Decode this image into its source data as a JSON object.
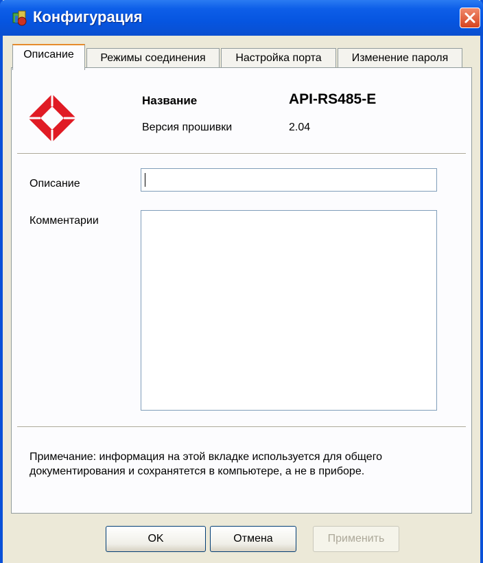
{
  "window": {
    "title": "Конфигурация",
    "close_icon": "close-x-icon",
    "app_icon": "configuration-tools-icon"
  },
  "tabs": [
    {
      "label": "Описание",
      "active": true
    },
    {
      "label": "Режимы соединения",
      "active": false
    },
    {
      "label": "Настройка порта",
      "active": false
    },
    {
      "label": "Изменение пароля",
      "active": false
    }
  ],
  "device": {
    "logo_icon": "red-diamond-logo",
    "name_label": "Название",
    "name_value": "API-RS485-E",
    "firmware_label": "Версия прошивки",
    "firmware_value": "2.04"
  },
  "form": {
    "description_label": "Описание",
    "description_value": "",
    "comments_label": "Комментарии",
    "comments_value": ""
  },
  "note": {
    "line1": "Примечание: информация на этой вкладке используется для общего",
    "line2": "документирования и сохранятется в компьютере, а не в приборе."
  },
  "buttons": {
    "ok": "OK",
    "cancel": "Отмена",
    "apply": "Применить"
  },
  "colors": {
    "titlebar": "#0655e0",
    "close": "#d6431e",
    "logo": "#e01b24",
    "dialog_bg": "#ece9d8"
  }
}
